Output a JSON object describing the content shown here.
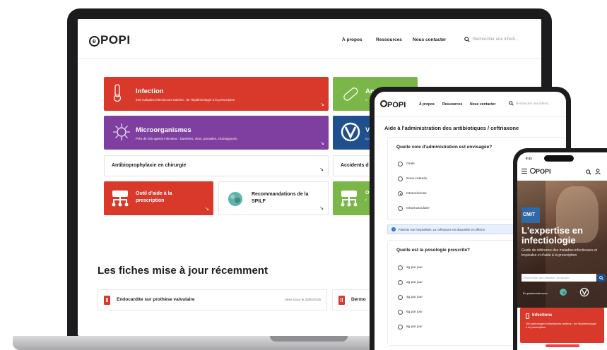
{
  "laptop": {
    "nav": {
      "logo": "POPI",
      "links": [
        "À propos",
        "Ressources",
        "Nous contacter"
      ],
      "search_placeholder": "Rechercher une infecti..."
    },
    "tiles": {
      "infection": {
        "title": "Infection",
        "subtitle": "260 maladies infectieuses traitées : de l'épidémiologie à la prescription",
        "color": "#d8392b"
      },
      "antibio": {
        "title": "An",
        "subtitle": "A",
        "color": "#7ab648"
      },
      "micro": {
        "title": "Microorganismes",
        "subtitle": "Près de 250 agents infectieux : bactéries, virus, parasites, champignons",
        "color": "#7e3fa0"
      },
      "vaccins": {
        "title": "V",
        "subtitle": "Co",
        "color": "#1f4f8f"
      },
      "antibioprophylaxie": {
        "title": "Antibioprophylaxie en chirurgie"
      },
      "accidents": {
        "title": "Accidents d"
      },
      "outil": {
        "title": "Outil d'aide à la prescription",
        "color": "#d8392b"
      },
      "spilf": {
        "title": "Recommandations de la SPILF"
      },
      "green": {
        "title": "O",
        "subtitle": "l'",
        "color": "#7ab648"
      }
    },
    "section_title": "Les fiches mise à jour récemment",
    "fiches": [
      {
        "title": "Endocardite sur prothèse valvulaire",
        "date": "Mise à jour le 20/04/2026"
      },
      {
        "title": "Dermo",
        "date": ""
      }
    ]
  },
  "tablet": {
    "nav": {
      "logo": "POPI",
      "links": [
        "À propos",
        "Ressources",
        "Nous contacter"
      ],
      "search_placeholder": "Rechercher une infecti..."
    },
    "heading": "Aide à l'administration des antibiotiques / ceftriaxone",
    "question1": "Quelle voie d'administration est envisagée?",
    "routes": [
      "Orale",
      "Sous-cutanée",
      "Intraveineuse",
      "Intramusculaire"
    ],
    "selected_route": "Intraveineuse",
    "info": "Patients non hospitalisés: La ceftriaxone est disponible en officine.",
    "question2": "Quelle est la posologie prescrite?",
    "doses": [
      "1g par jour",
      "2g par jour",
      "4g par jour",
      "6g par jour",
      "8g par jour"
    ]
  },
  "phone": {
    "time": "9:41",
    "logo": "POPI",
    "badge": "CMIT",
    "hero_title": "L'expertise en infectiologie",
    "hero_lead": "Guide de référence des maladies infectieuses et tropicales et d'aide à la prescription",
    "search_placeholder": "Rechercher une infection, un vaccin...",
    "partner": "En partenariat avec",
    "card": {
      "title": "Infections",
      "subtitle": "260 pathologies infectieuses traitées : de l'épidémiologie à la prescription"
    }
  }
}
